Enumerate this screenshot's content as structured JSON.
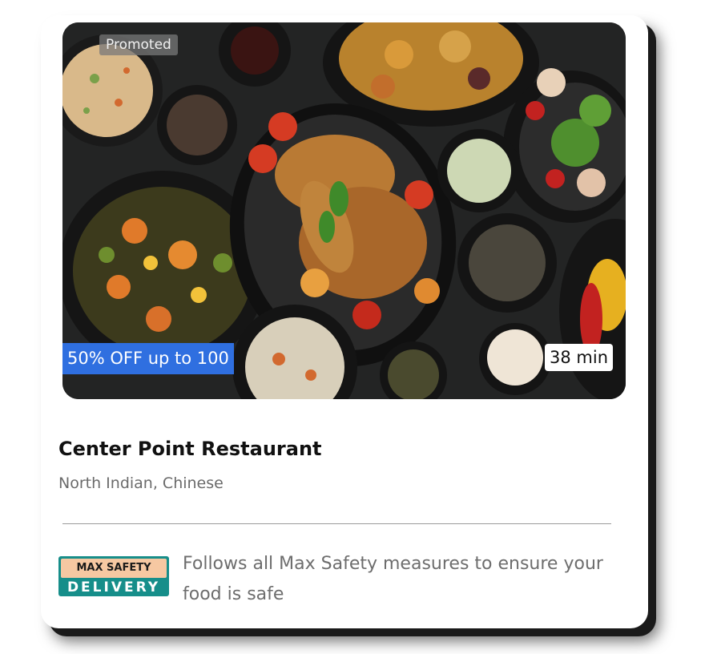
{
  "restaurant": {
    "name": "Center Point Restaurant",
    "cuisine": "North Indian, Chinese",
    "promoted_label": "Promoted",
    "offer": "50% OFF up to 100",
    "eta": "38 min"
  },
  "safety": {
    "badge_top": "MAX SAFETY",
    "badge_bottom": "DELIVERY",
    "text": "Follows all Max Safety measures to ensure your food is safe"
  },
  "colors": {
    "offer_bg": "#2f6fe0",
    "badge_teal": "#168e8a",
    "badge_peach": "#f6c8a2"
  }
}
